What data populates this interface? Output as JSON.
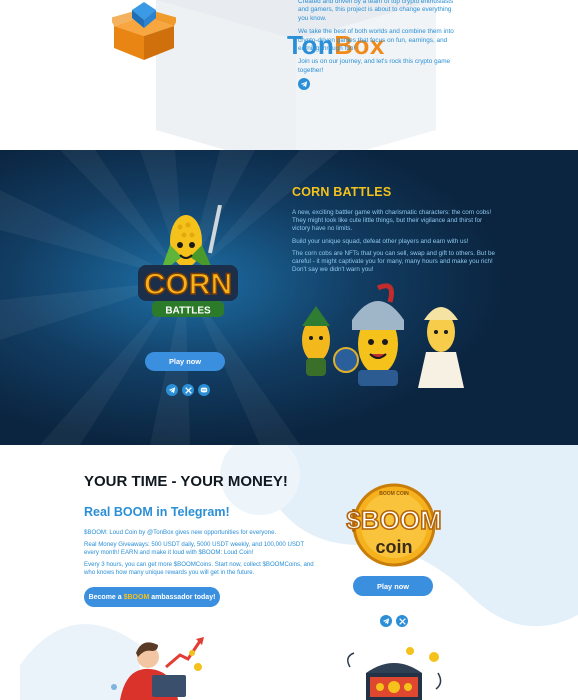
{
  "brand": {
    "logo_ton": "Ton",
    "logo_box": "Box",
    "paragraphs": [
      "Created and driven by a team of top crypto enthusiasts and gamers, this project is about to change everything you know.",
      "We take the best of both worlds and combine them into crypto-driven games that focus on fun, earnings, and earning through fun!",
      "Join us on our journey, and let's rock this crypto game together!"
    ],
    "social_icon": "telegram-icon"
  },
  "corn_battles": {
    "title": "CORN BATTLES",
    "logo_word_top": "CORN",
    "logo_word_bottom": "BATTLES",
    "paragraphs": [
      "A new, exciting battler game with charismatic characters: the corn cobs! They might look like cute little things, but their vigilance and thirst for victory have no limits.",
      "Build your unique squad, defeat other players and earn with us!",
      "The corn cobs are NFTs that you can sell, swap and gift to others. But be careful - it might captivate you for many, many hours and make you rich! Don't say we didn't warn you!"
    ],
    "play_label": "Play now",
    "social_icons": [
      "telegram-icon",
      "x-icon",
      "discord-icon"
    ]
  },
  "money": {
    "title": "YOUR TIME - YOUR MONEY!",
    "subtitle": "Real BOOM in Telegram!",
    "paragraphs": [
      "$BOOM: Loud Coin by @TonBox gives new opportunities for everyone.",
      "Real Money Giveaways: 500 USDT daily, 5000 USDT weekly, and 100,000 USDT every month! EARN and make it loud with $BOOM: Loud Coin!",
      "Every 3 hours, you can get more $BOOMCoins. Start now, collect $BOOMCoins, and who knows how many unique rewards you will get in the future."
    ],
    "ambassador_prefix": "Become a ",
    "ambassador_highlight": "$BOOM",
    "ambassador_suffix": " ambassador today!",
    "coin_line1": "$BOOM",
    "coin_line2": "coin",
    "coin_ring": "BOOM COIN",
    "play_label": "Play now",
    "social_icons": [
      "telegram-icon",
      "x-icon"
    ]
  },
  "colors": {
    "brand_blue": "#2a8fd6",
    "brand_orange": "#f08a1a",
    "corn_bg": "#0d2a47",
    "gold": "#f5c21b",
    "button_blue": "#3b8fdf"
  }
}
